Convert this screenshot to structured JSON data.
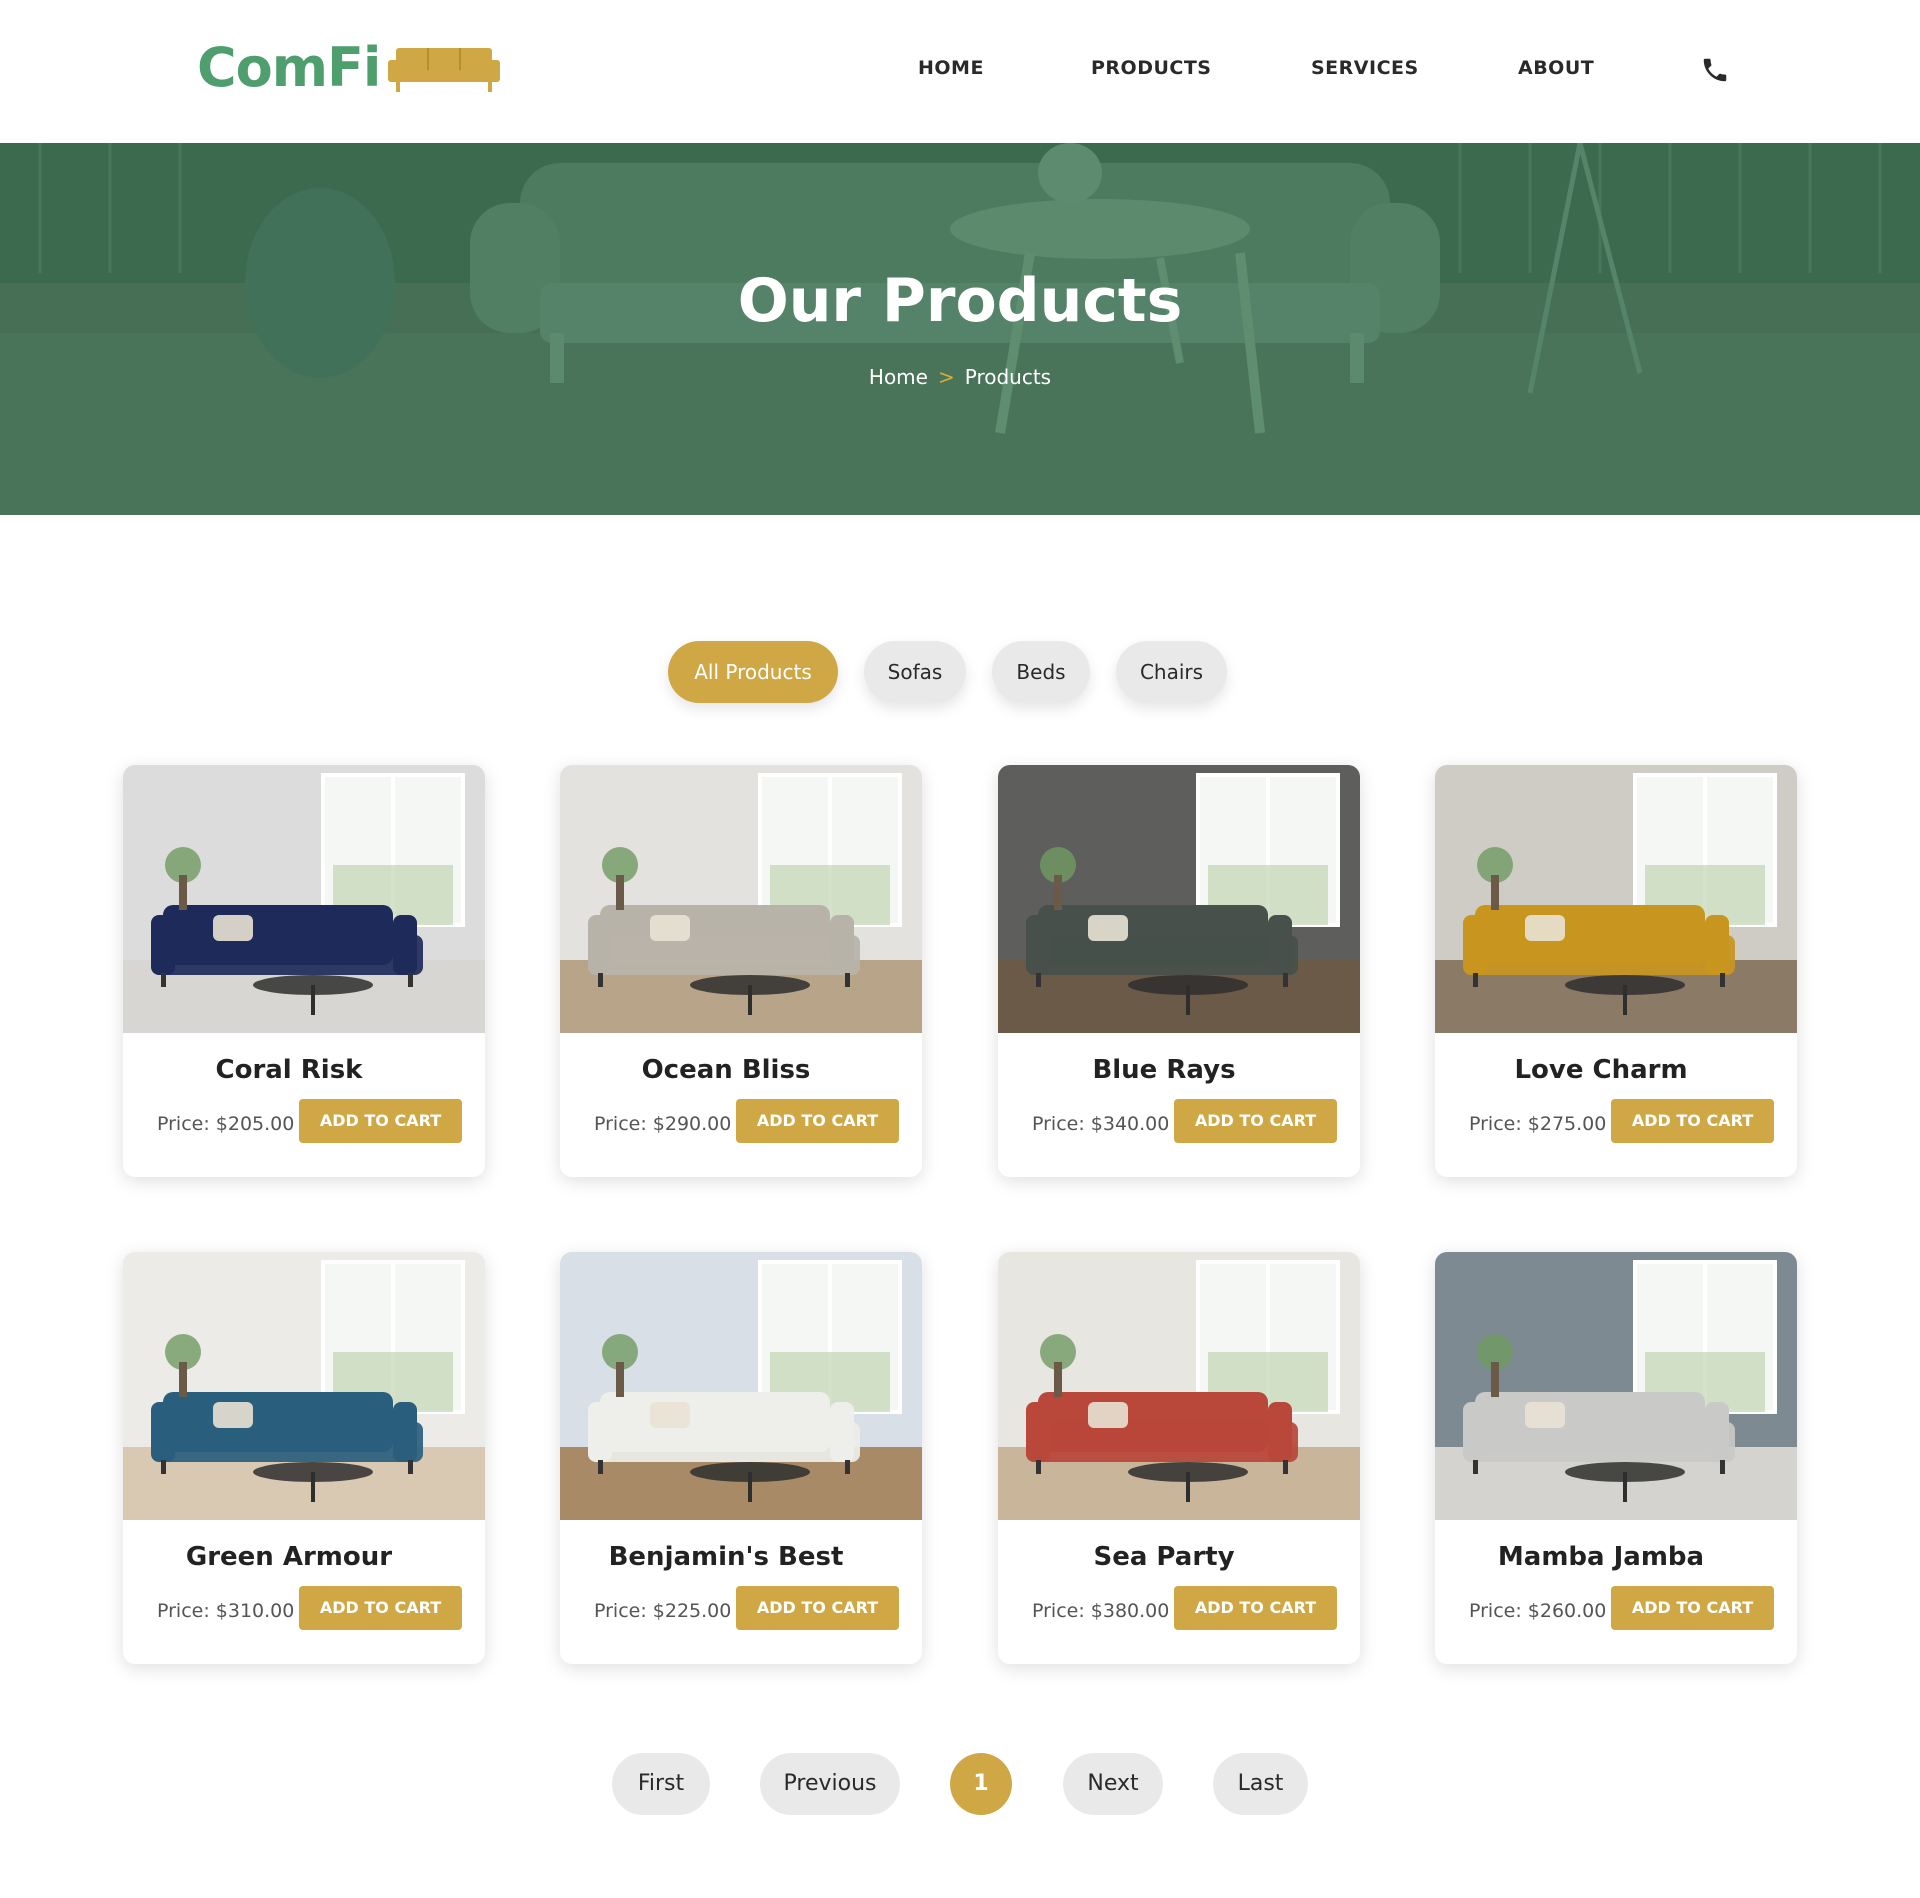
{
  "brand": {
    "logo_text": "ComFi",
    "colors": {
      "green": "#4e9e6e",
      "gold": "#cfa845",
      "hero_overlay": "#3f6d51",
      "dark": "#2a2a2a"
    }
  },
  "nav": {
    "items": [
      "HOME",
      "PRODUCTS",
      "SERVICES",
      "ABOUT"
    ],
    "phone_icon": "phone-icon"
  },
  "hero": {
    "title": "Our Products",
    "breadcrumb": {
      "home": "Home",
      "separator": ">",
      "current": "Products"
    }
  },
  "filters": {
    "items": [
      "All Products",
      "Sofas",
      "Beds",
      "Chairs"
    ],
    "active": "All Products"
  },
  "products": [
    {
      "name": "Coral Risk",
      "price": "Price: $205.00",
      "button": "ADD TO CART",
      "sofa_color": "#1e2a5a"
    },
    {
      "name": "Ocean Bliss",
      "price": "Price: $290.00",
      "button": "ADD TO CART",
      "sofa_color": "#b8b3a9"
    },
    {
      "name": "Blue Rays",
      "price": "Price: $340.00",
      "button": "ADD TO CART",
      "sofa_color": "#47504b"
    },
    {
      "name": "Love Charm",
      "price": "Price: $275.00",
      "button": "ADD TO CART",
      "sofa_color": "#c8961f"
    },
    {
      "name": "Green Armour",
      "price": "Price: $310.00",
      "button": "ADD TO CART",
      "sofa_color": "#2a5e7d"
    },
    {
      "name": "Benjamin's Best",
      "price": "Price: $225.00",
      "button": "ADD TO CART",
      "sofa_color": "#eeeeea"
    },
    {
      "name": "Sea Party",
      "price": "Price: $380.00",
      "button": "ADD TO CART",
      "sofa_color": "#b9473a"
    },
    {
      "name": "Mamba Jamba",
      "price": "Price: $260.00",
      "button": "ADD TO CART",
      "sofa_color": "#c9c9c7"
    }
  ],
  "pagination": {
    "first": "First",
    "previous": "Previous",
    "current": "1",
    "next": "Next",
    "last": "Last"
  }
}
